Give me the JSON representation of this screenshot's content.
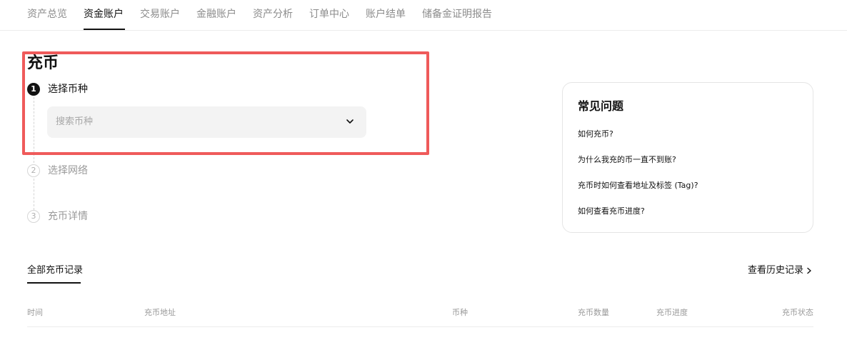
{
  "nav": {
    "tabs": [
      "资产总览",
      "资金账户",
      "交易账户",
      "金融账户",
      "资产分析",
      "订单中心",
      "账户结单",
      "储备金证明报告"
    ],
    "active_index": 1
  },
  "page_title": "充币",
  "steps": [
    {
      "number": "1",
      "label": "选择币种",
      "active": true
    },
    {
      "number": "2",
      "label": "选择网络",
      "active": false
    },
    {
      "number": "3",
      "label": "充币详情",
      "active": false
    }
  ],
  "coin_select": {
    "placeholder": "搜索币种",
    "icon": "chevron-down-icon"
  },
  "faq": {
    "title": "常见问题",
    "items": [
      "如何充币?",
      "为什么我充的币一直不到账?",
      "充币时如何查看地址及标签 (Tag)?",
      "如何查看充币进度?"
    ]
  },
  "records": {
    "tab_label": "全部充币记录",
    "history_link": "查看历史记录",
    "columns": [
      "时间",
      "充币地址",
      "币种",
      "充币数量",
      "充币进度",
      "充币状态"
    ]
  },
  "colors": {
    "highlight": "#ef5a5a",
    "text": "#121212",
    "muted": "#9a9a9a"
  }
}
